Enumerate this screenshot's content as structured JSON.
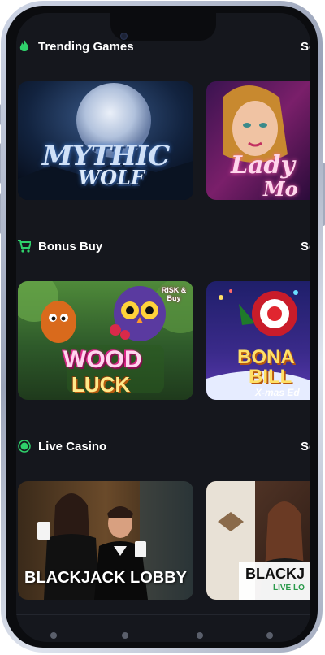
{
  "sections": [
    {
      "title": "Trending Games",
      "see_all": "See all",
      "icon": "flame-icon",
      "games": [
        {
          "title_line1": "MYTHIC",
          "title_line2": "WOLF",
          "name": "Mythic Wolf"
        },
        {
          "title_line1": "Lady",
          "title_line2": "Mo",
          "name": "Lady of the Moon"
        }
      ]
    },
    {
      "title": "Bonus Buy",
      "see_all": "See all",
      "icon": "cart-icon",
      "games": [
        {
          "title_line1": "WOOD",
          "title_line2": "LUCK",
          "badge": "RISK & Buy",
          "name": "Wood Luck"
        },
        {
          "title_line1": "BONA",
          "title_line2": "BILL",
          "subtitle": "X-mas Ed",
          "name": "Bonanza Billion X-mas Edition"
        }
      ]
    },
    {
      "title": "Live Casino",
      "see_all": "See all",
      "icon": "live-dot-icon",
      "games": [
        {
          "title_line1": "BLACKJACK LOBBY",
          "name": "Blackjack Lobby"
        },
        {
          "title_line1": "BLACKJ",
          "subtitle": "LIVE LO",
          "name": "Blackjack Live Lounge"
        }
      ]
    }
  ],
  "colors": {
    "background": "#15171d",
    "accent": "#2fd16b",
    "text": "#ffffff"
  }
}
